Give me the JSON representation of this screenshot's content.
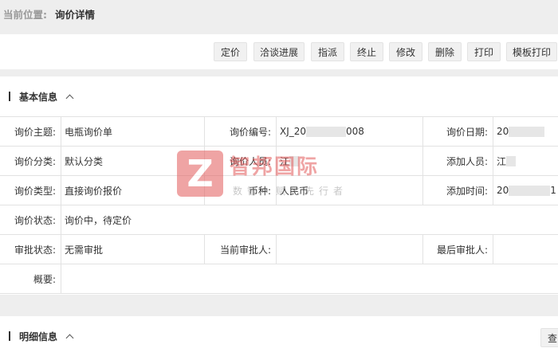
{
  "breadcrumb": {
    "prefix": "当前位置:",
    "current": "询价详情"
  },
  "toolbar": {
    "buttons": [
      "定价",
      "洽谈进展",
      "指派",
      "终止",
      "修改",
      "删除",
      "打印",
      "模板打印"
    ]
  },
  "basic_info": {
    "title": "基本信息",
    "rows": [
      [
        {
          "label": "询价主题:",
          "value": "电瓶询价单"
        },
        {
          "label": "询价编号:",
          "value_prefix": "XJ_20",
          "value_suffix": "008"
        },
        {
          "label": "询价日期:",
          "value_prefix": "20"
        }
      ],
      [
        {
          "label": "询价分类:",
          "value": "默认分类"
        },
        {
          "label": "询价人员:",
          "value_prefix": "江"
        },
        {
          "label": "添加人员:",
          "value_prefix": "江"
        }
      ],
      [
        {
          "label": "询价类型:",
          "value": "直接询价报价"
        },
        {
          "label": "币种:",
          "value": "人民币"
        },
        {
          "label": "添加时间:",
          "value_prefix": "20",
          "value_suffix": "1"
        }
      ],
      [
        {
          "label": "询价状态:",
          "value": "询价中，待定价"
        }
      ],
      [
        {
          "label": "审批状态:",
          "value": "无需审批"
        },
        {
          "label": "当前审批人:",
          "value": ""
        },
        {
          "label": "最后审批人:",
          "value": ""
        }
      ],
      [
        {
          "label": "概要:",
          "value": ""
        }
      ]
    ]
  },
  "detail_info": {
    "title": "明细信息",
    "button": "查"
  },
  "watermark": {
    "logo_letter": "Z",
    "brand": "智邦国际",
    "slogan": "数智・赋化先行者",
    "color": "#e25a5a"
  }
}
